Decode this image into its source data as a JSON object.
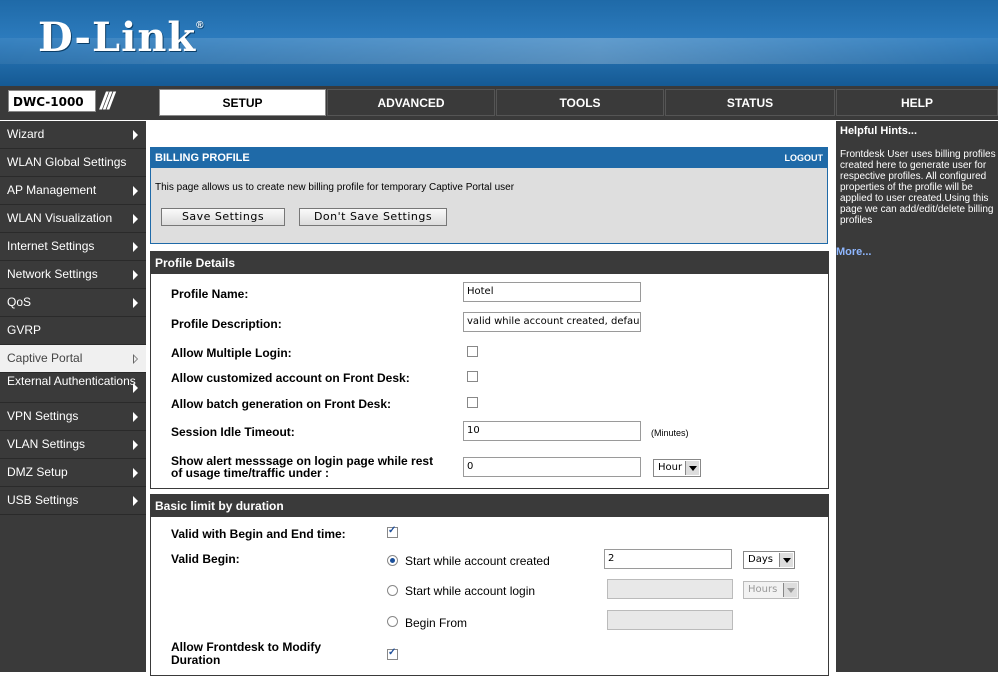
{
  "brand": {
    "logo": "D-Link",
    "reg": "®",
    "model": "DWC-1000"
  },
  "tabs": [
    {
      "label": "SETUP"
    },
    {
      "label": "ADVANCED"
    },
    {
      "label": "TOOLS"
    },
    {
      "label": "STATUS"
    },
    {
      "label": "HELP"
    }
  ],
  "sidebar": {
    "items": [
      {
        "label": "Wizard"
      },
      {
        "label": "WLAN Global Settings"
      },
      {
        "label": "AP Management"
      },
      {
        "label": "WLAN Visualization"
      },
      {
        "label": "Internet Settings"
      },
      {
        "label": "Network Settings"
      },
      {
        "label": "QoS"
      },
      {
        "label": "GVRP"
      },
      {
        "label": "Captive Portal"
      },
      {
        "label": "External Authentications"
      },
      {
        "label": "VPN Settings"
      },
      {
        "label": "VLAN Settings"
      },
      {
        "label": "DMZ Setup"
      },
      {
        "label": "USB Settings"
      }
    ]
  },
  "billing": {
    "title": "BILLING PROFILE",
    "logout": "LOGOUT",
    "description": "This page allows us to create new billing profile for temporary Captive Portal user",
    "save": "Save Settings",
    "dont_save": "Don't Save Settings"
  },
  "profile": {
    "title": "Profile Details",
    "name_label": "Profile Name:",
    "name_value": "Hotel",
    "desc_label": "Profile Description:",
    "desc_value": "valid while account created, default",
    "multi_label": "Allow Multiple Login:",
    "custom_label": "Allow customized account on Front Desk:",
    "batch_label": "Allow batch generation on Front Desk:",
    "idle_label": "Session Idle Timeout:",
    "idle_value": "10",
    "idle_unit": "(Minutes)",
    "alert_label_1": "Show alert messsage on login page while rest",
    "alert_label_2": "of usage time/traffic under :",
    "alert_value": "0",
    "alert_unit": "Hour"
  },
  "duration": {
    "title": "Basic limit by duration",
    "valid_label": "Valid with Begin and End time:",
    "begin_label": "Valid Begin:",
    "opt1": "Start while account created",
    "opt1_value": "2",
    "opt1_unit": "Days",
    "opt2": "Start while account login",
    "opt2_unit": "Hours",
    "opt3": "Begin From",
    "modify_label_1": "Allow Frontdesk to Modify",
    "modify_label_2": "Duration"
  },
  "hints": {
    "title": "Helpful Hints...",
    "text": "Frontdesk User uses billing profiles created here to generate user for respective profiles. All configured properties of the profile will be applied to user created.Using this page we can add/edit/delete billing profiles",
    "more": "More..."
  },
  "colors": {
    "accent": "#1f6aa8",
    "dark": "#3a3a3a"
  }
}
